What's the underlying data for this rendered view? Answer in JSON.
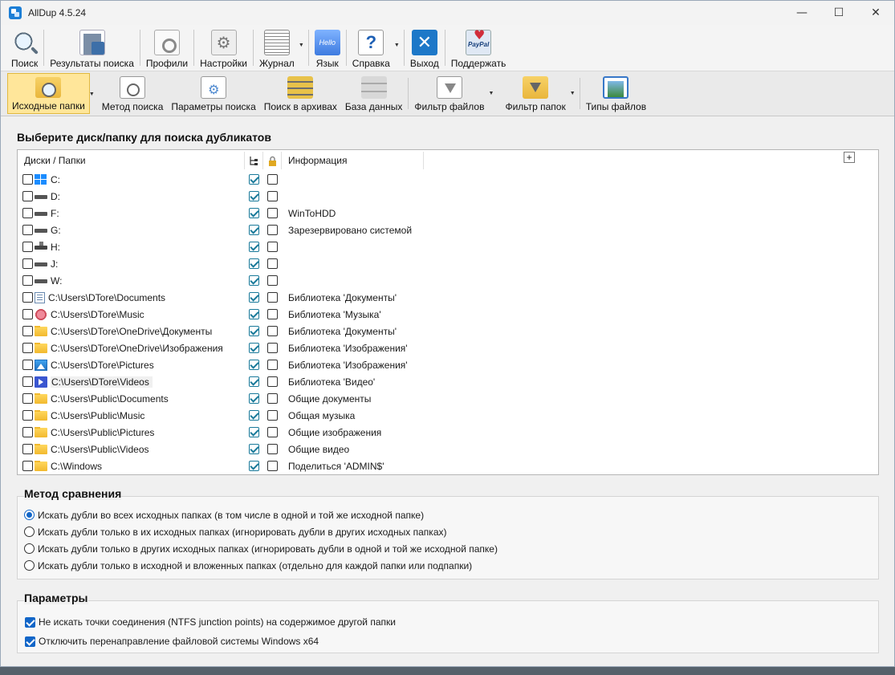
{
  "window": {
    "title": "AllDup 4.5.24",
    "controls": {
      "minimize": "—",
      "maximize": "☐",
      "close": "✕"
    }
  },
  "toolbar_main": [
    {
      "label": "Поиск",
      "icon": "search-icon"
    },
    {
      "label": "Результаты поиска",
      "icon": "results-icon"
    },
    {
      "label": "Профили",
      "icon": "profiles-icon"
    },
    {
      "label": "Настройки",
      "icon": "settings-icon"
    },
    {
      "label": "Журнал",
      "icon": "log-icon",
      "dropdown": true
    },
    {
      "label": "Язык",
      "icon": "language-icon",
      "icon_text": "Hello"
    },
    {
      "label": "Справка",
      "icon": "help-icon",
      "icon_text": "?",
      "dropdown": true
    },
    {
      "label": "Выход",
      "icon": "exit-icon",
      "icon_text": "✕"
    },
    {
      "label": "Поддержать",
      "icon": "paypal-icon"
    }
  ],
  "toolbar_search": [
    {
      "label": "Исходные папки",
      "icon": "source-folders-icon",
      "active": true,
      "dropdown": true
    },
    {
      "label": "Метод поиска",
      "icon": "search-method-icon"
    },
    {
      "label": "Параметры поиска",
      "icon": "search-params-icon"
    },
    {
      "label": "Поиск в архивах",
      "icon": "archive-icon"
    },
    {
      "label": "База данных",
      "icon": "database-icon"
    },
    {
      "label": "Фильтр файлов",
      "icon": "file-filter-icon",
      "dropdown": true
    },
    {
      "label": "Фильтр папок",
      "icon": "folder-filter-icon",
      "dropdown": true
    },
    {
      "label": "Типы файлов",
      "icon": "file-types-icon"
    }
  ],
  "folders": {
    "section_title": "Выберите диск/папку для поиска дубликатов",
    "header": {
      "name": "Диски / Папки",
      "subfolders_icon": "subfolders-icon",
      "lock_icon": "lock-icon",
      "info": "Информация",
      "expand": "+"
    },
    "rows": [
      {
        "path": "C:",
        "icon": "windows-drive-icon",
        "info": ""
      },
      {
        "path": "D:",
        "icon": "drive-icon",
        "info": ""
      },
      {
        "path": "F:",
        "icon": "drive-icon",
        "info": "WinToHDD"
      },
      {
        "path": "G:",
        "icon": "drive-icon",
        "info": "Зарезервировано системой"
      },
      {
        "path": "H:",
        "icon": "network-drive-icon",
        "info": ""
      },
      {
        "path": "J:",
        "icon": "drive-icon",
        "info": ""
      },
      {
        "path": "W:",
        "icon": "drive-icon",
        "info": ""
      },
      {
        "path": "C:\\Users\\DTore\\Documents",
        "icon": "documents-icon",
        "info": "Библиотека 'Документы'"
      },
      {
        "path": "C:\\Users\\DTore\\Music",
        "icon": "music-icon",
        "info": "Библиотека 'Музыка'"
      },
      {
        "path": "C:\\Users\\DTore\\OneDrive\\Документы",
        "icon": "folder-icon",
        "info": "Библиотека 'Документы'"
      },
      {
        "path": "C:\\Users\\DTore\\OneDrive\\Изображения",
        "icon": "folder-icon",
        "info": "Библиотека 'Изображения'"
      },
      {
        "path": "C:\\Users\\DTore\\Pictures",
        "icon": "pictures-icon",
        "info": "Библиотека 'Изображения'"
      },
      {
        "path": "C:\\Users\\DTore\\Videos",
        "icon": "videos-icon",
        "info": "Библиотека 'Видео'",
        "highlight": true
      },
      {
        "path": "C:\\Users\\Public\\Documents",
        "icon": "folder-icon",
        "info": "Общие документы"
      },
      {
        "path": "C:\\Users\\Public\\Music",
        "icon": "folder-icon",
        "info": "Общая музыка"
      },
      {
        "path": "C:\\Users\\Public\\Pictures",
        "icon": "folder-icon",
        "info": "Общие изображения"
      },
      {
        "path": "C:\\Users\\Public\\Videos",
        "icon": "folder-icon",
        "info": "Общие видео"
      },
      {
        "path": "C:\\Windows",
        "icon": "folder-icon",
        "info": "Поделиться 'ADMIN$'"
      }
    ]
  },
  "compare_method": {
    "title": "Метод сравнения",
    "selected_index": 0,
    "options": [
      "Искать дубли во всех исходных папках (в том числе в одной и той же исходной папке)",
      "Искать дубли только в их исходных папках (игнорировать дубли в других исходных папках)",
      "Искать дубли только в других исходных папках (игнорировать дубли в одной и той же исходной папке)",
      "Искать дубли только в исходной и вложенных папках (отдельно для каждой папки или подпапки)"
    ]
  },
  "parameters": {
    "title": "Параметры",
    "options": [
      {
        "label": "Не искать точки соединения (NTFS junction points) на содержимое другой папки",
        "checked": true
      },
      {
        "label": "Отключить перенаправление файловой системы Windows x64",
        "checked": true
      }
    ]
  }
}
